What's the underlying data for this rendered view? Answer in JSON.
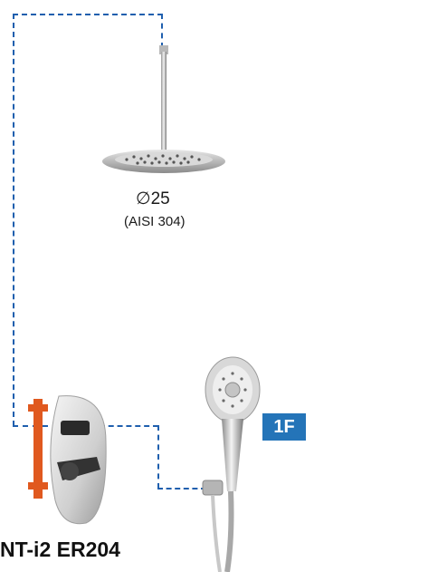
{
  "shower_head": {
    "diameter_symbol": "∅",
    "diameter": "25",
    "material": "(AISI 304)"
  },
  "badge": {
    "label": "1F"
  },
  "product": {
    "model": "NT-i2 ER204"
  },
  "colors": {
    "pipe_dash": "#1f5fae",
    "badge_bg": "#2474b8",
    "valve_bracket": "#e0591f"
  },
  "icons": [
    "ceiling-rain-shower-head",
    "hand-shower",
    "concealed-mixer-valve"
  ]
}
